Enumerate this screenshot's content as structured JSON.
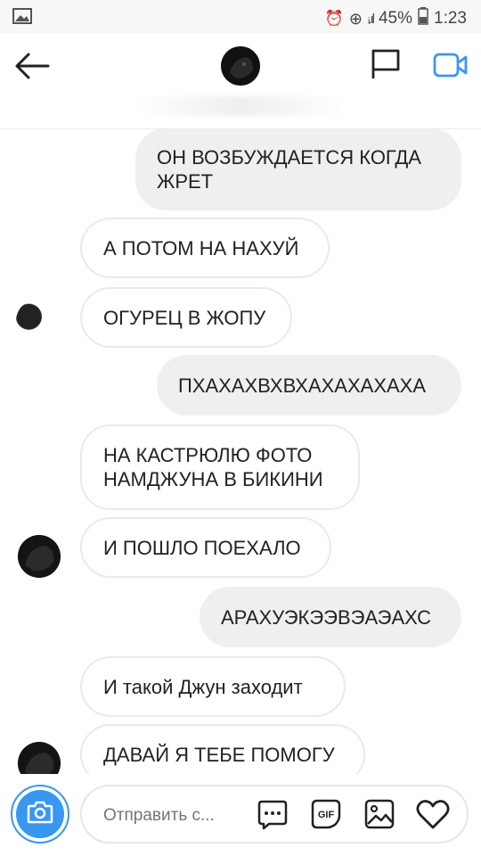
{
  "statusbar": {
    "battery": "45%",
    "time": "1:23"
  },
  "messages": [
    {
      "side": "me",
      "text": "ОН ВОЗБУЖДАЕТСЯ КОГДА ЖРЕТ"
    },
    {
      "side": "them",
      "text": "А ПОТОМ НА НАХУЙ"
    },
    {
      "side": "them",
      "text": "ОГУРЕЦ В ЖОПУ"
    },
    {
      "side": "me",
      "text": "ПХАХАХВХВХАХАХАХАХА"
    },
    {
      "side": "them",
      "text": "НА КАСТРЮЛЮ ФОТО НАМДЖУНА В БИКИНИ"
    },
    {
      "side": "them",
      "text": "И ПОШЛО ПОЕХАЛО"
    },
    {
      "side": "me",
      "text": "АРАХУЭКЭЭВЭАЭАХС"
    },
    {
      "side": "them",
      "text": "И такой Джун заходит"
    },
    {
      "side": "them",
      "text": "ДАВАЙ Я ТЕБЕ ПОМОГУ"
    }
  ],
  "composer": {
    "placeholder": "Отправить с..."
  },
  "colors": {
    "accent": "#3897f0",
    "them_bubble_border": "#eaeaea",
    "me_bubble_bg": "#efefef"
  },
  "icons": [
    "back-arrow-icon",
    "flag-icon",
    "video-call-icon",
    "camera-icon",
    "sticker-icon",
    "gif-icon",
    "gallery-icon",
    "heart-icon"
  ]
}
